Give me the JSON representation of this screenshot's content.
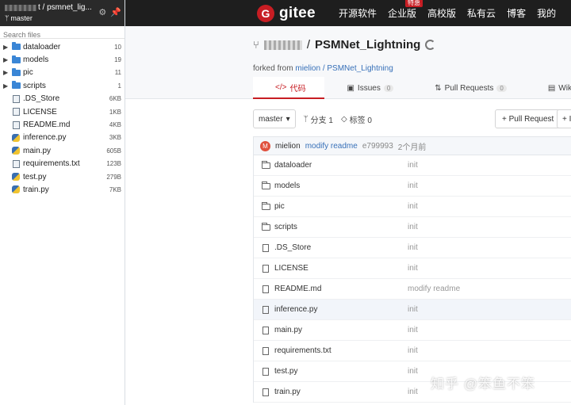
{
  "sidebar": {
    "repo_path": "t / psmnet_lig...",
    "branch": "master",
    "search_placeholder": "Search files",
    "folders": [
      {
        "name": "dataloader",
        "size": "10"
      },
      {
        "name": "models",
        "size": "19"
      },
      {
        "name": "pic",
        "size": "11"
      },
      {
        "name": "scripts",
        "size": "1"
      }
    ],
    "files": [
      {
        "name": ".DS_Store",
        "size": "6KB",
        "icon": "file-icon"
      },
      {
        "name": "LICENSE",
        "size": "1KB",
        "icon": "file-icon"
      },
      {
        "name": "README.md",
        "size": "4KB",
        "icon": "file-icon"
      },
      {
        "name": "inference.py",
        "size": "3KB",
        "icon": "python-icon"
      },
      {
        "name": "main.py",
        "size": "605B",
        "icon": "python-icon"
      },
      {
        "name": "requirements.txt",
        "size": "123B",
        "icon": "file-icon"
      },
      {
        "name": "test.py",
        "size": "279B",
        "icon": "python-icon"
      },
      {
        "name": "train.py",
        "size": "7KB",
        "icon": "python-icon"
      }
    ]
  },
  "topnav": {
    "logo_text": "gitee",
    "items": [
      "开源软件",
      "企业版",
      "高校版",
      "私有云",
      "博客",
      "我的"
    ],
    "badge": "特惠"
  },
  "repo": {
    "owner_sep": "/",
    "name": "PSMNet_Lightning",
    "forked_prefix": "forked from",
    "forked_from": "mielion / PSMNet_Lightning",
    "tabs": [
      {
        "label": "代码",
        "count": ""
      },
      {
        "label": "Issues",
        "count": "0"
      },
      {
        "label": "Pull Requests",
        "count": "0"
      },
      {
        "label": "Wiki",
        "count": ""
      }
    ]
  },
  "toolbar": {
    "branch": "master",
    "branches": "分支 1",
    "tags": "标签 0",
    "pull_request": "+ Pull Request",
    "issue": "+ Is"
  },
  "commit": {
    "avatar_letter": "M",
    "author": "mielion",
    "message": "modify readme",
    "hash": "e799993",
    "time": "2个月前"
  },
  "files": [
    {
      "name": "dataloader",
      "msg": "init",
      "type": "folder"
    },
    {
      "name": "models",
      "msg": "init",
      "type": "folder"
    },
    {
      "name": "pic",
      "msg": "init",
      "type": "folder"
    },
    {
      "name": "scripts",
      "msg": "init",
      "type": "folder"
    },
    {
      "name": ".DS_Store",
      "msg": "init",
      "type": "file"
    },
    {
      "name": "LICENSE",
      "msg": "init",
      "type": "file"
    },
    {
      "name": "README.md",
      "msg": "modify readme",
      "type": "file"
    },
    {
      "name": "inference.py",
      "msg": "init",
      "type": "file"
    },
    {
      "name": "main.py",
      "msg": "init",
      "type": "file"
    },
    {
      "name": "requirements.txt",
      "msg": "init",
      "type": "file"
    },
    {
      "name": "test.py",
      "msg": "init",
      "type": "file"
    },
    {
      "name": "train.py",
      "msg": "init",
      "type": "file"
    }
  ],
  "watermark": "知乎 @笨鱼不笨"
}
